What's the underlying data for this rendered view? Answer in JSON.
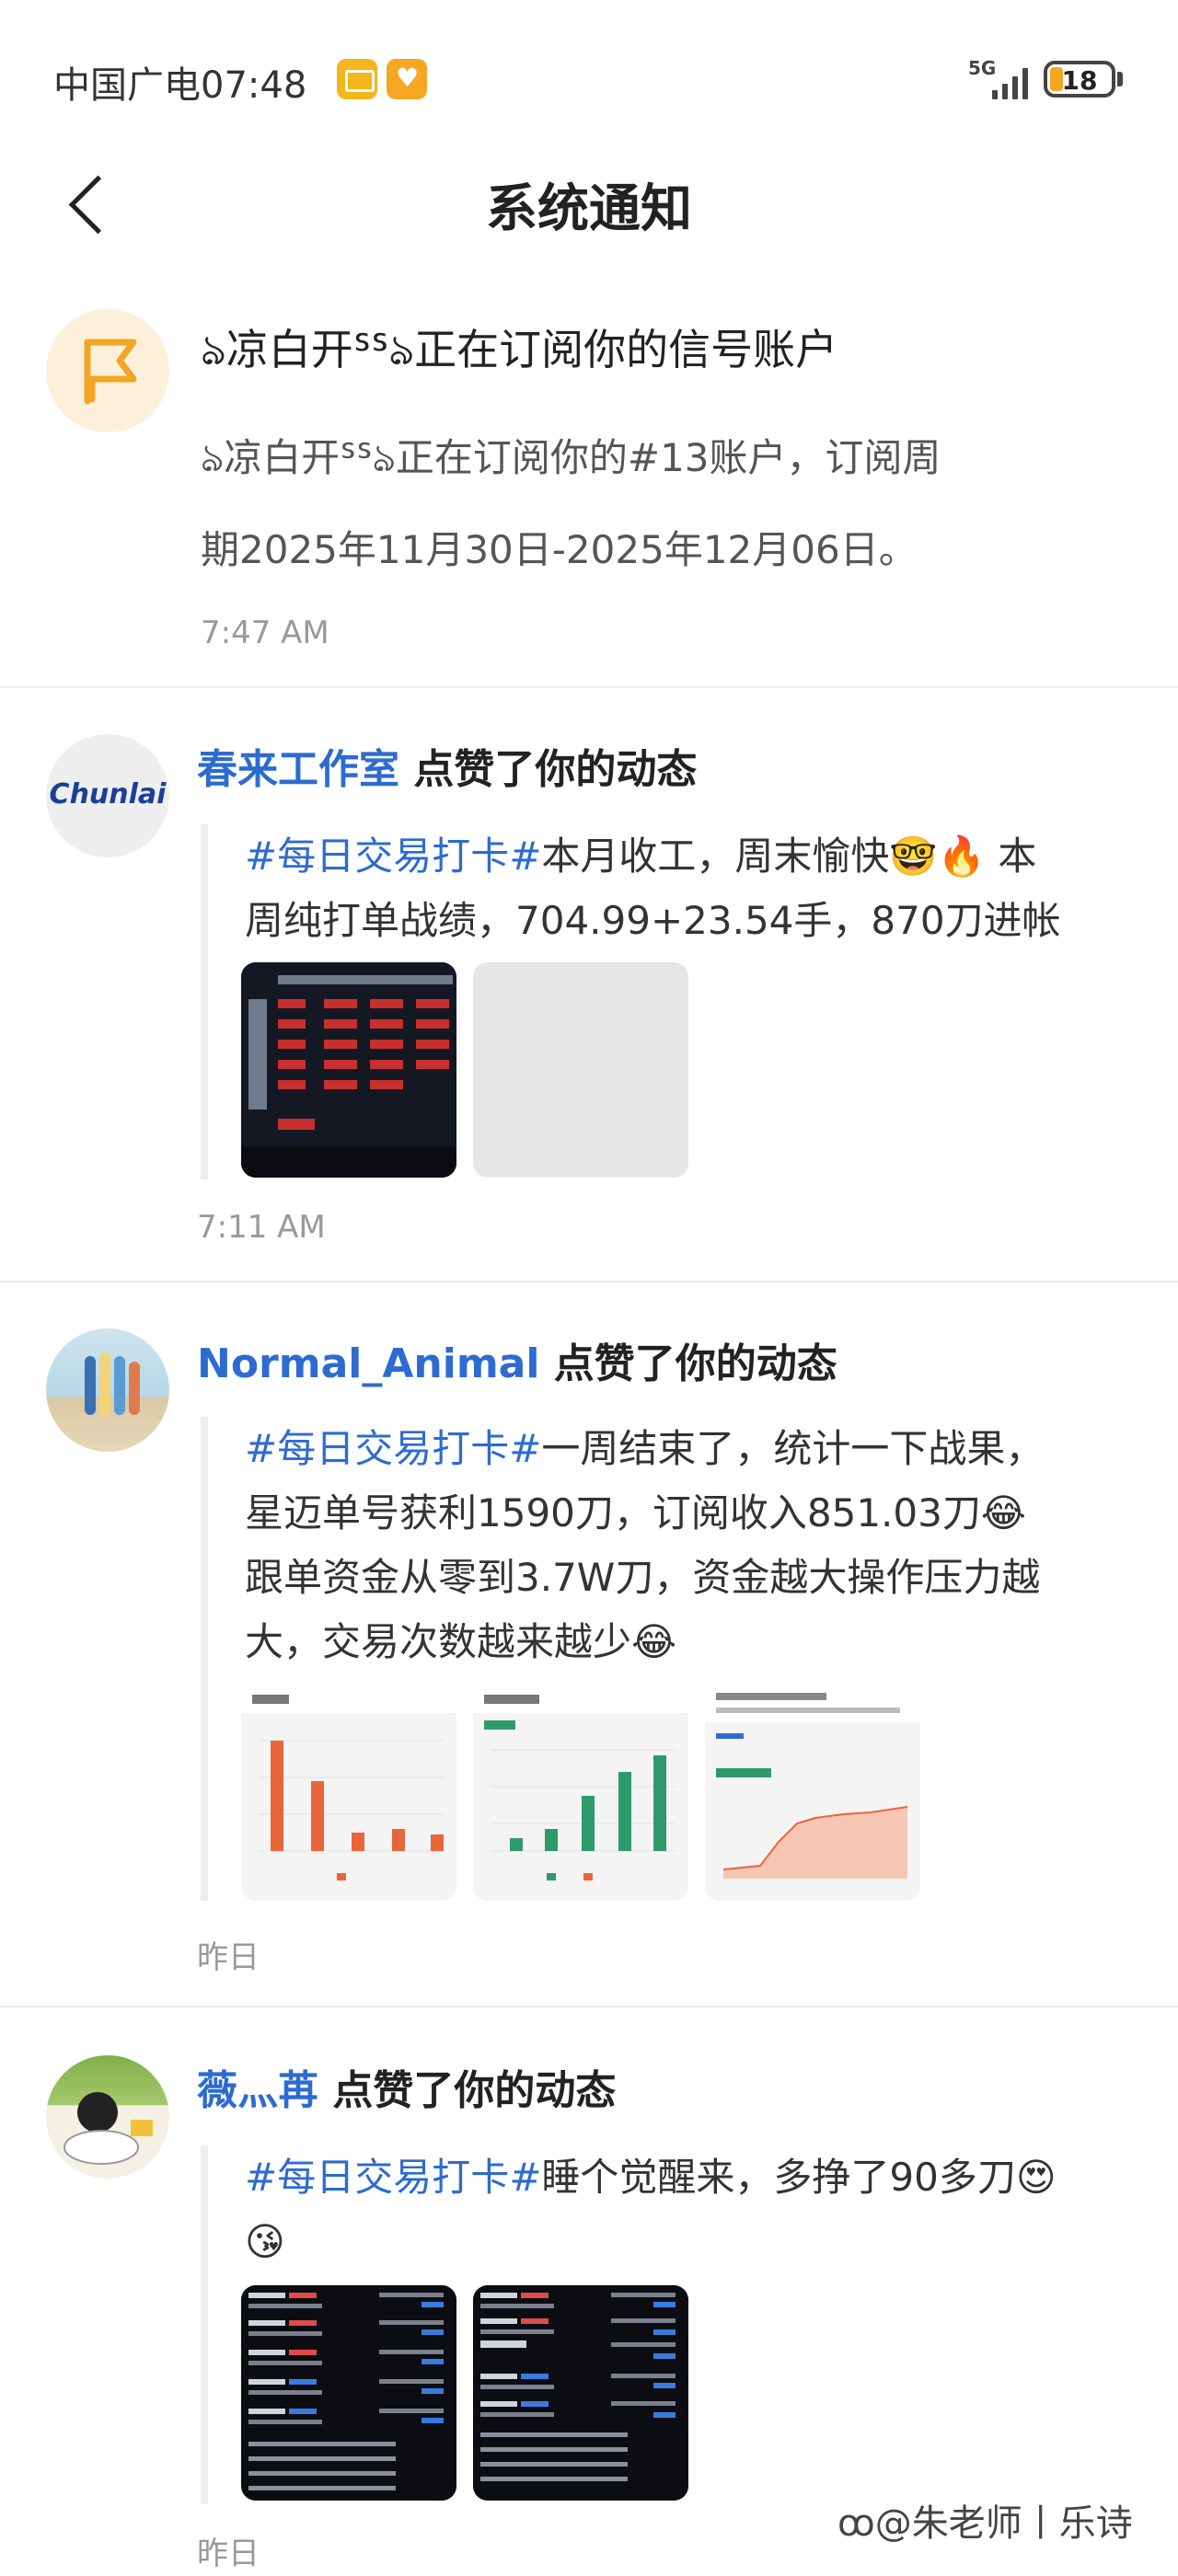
{
  "status_bar": {
    "carrier": "中国广电",
    "time": "07:48",
    "network": "5G",
    "battery": "18"
  },
  "header": {
    "title": "系统通知"
  },
  "notifications": [
    {
      "title": "ঌ凉白开ᔆᔆঌ正在订阅你的信号账户",
      "body_line1": "ঌ凉白开ᔆᔆঌ正在订阅你的#13账户，订阅周",
      "body_line2": "期2025年11月30日-2025年12月06日。",
      "time": "7:47 AM"
    },
    {
      "user": "春来工作室",
      "action": "点赞了你的动态",
      "avatar_text": "Chunlai",
      "hashtag": "#每日交易打卡#",
      "text_line1_rest": "本月收工，周末愉快🤓🔥 本",
      "text_line2": "周纯打单战绩，704.99+23.54手，870刀进帐",
      "time": "7:11 AM"
    },
    {
      "user": "Normal_Animal",
      "action": "点赞了你的动态",
      "hashtag": "#每日交易打卡#",
      "text_line1_rest": "一周结束了，统计一下战果，",
      "text_line2": "星迈单号获利1590刀，订阅收入851.03刀😂",
      "text_line3": "跟单资金从零到3.7W刀，资金越大操作压力越",
      "text_line4": "大，交易次数越来越少😂",
      "time": "昨日"
    },
    {
      "user": "薇灬苒",
      "action": "点赞了你的动态",
      "hashtag": "#每日交易打卡#",
      "text_line1_rest": "睡个觉醒来，多挣了90多刀😍",
      "text_line2": "😘",
      "time": "昨日"
    }
  ],
  "watermark": "ꝏ@朱老师丨乐诗",
  "colors": {
    "link_blue": "#2d6bd1",
    "text_dark": "#222222",
    "text_gray": "#999999"
  }
}
